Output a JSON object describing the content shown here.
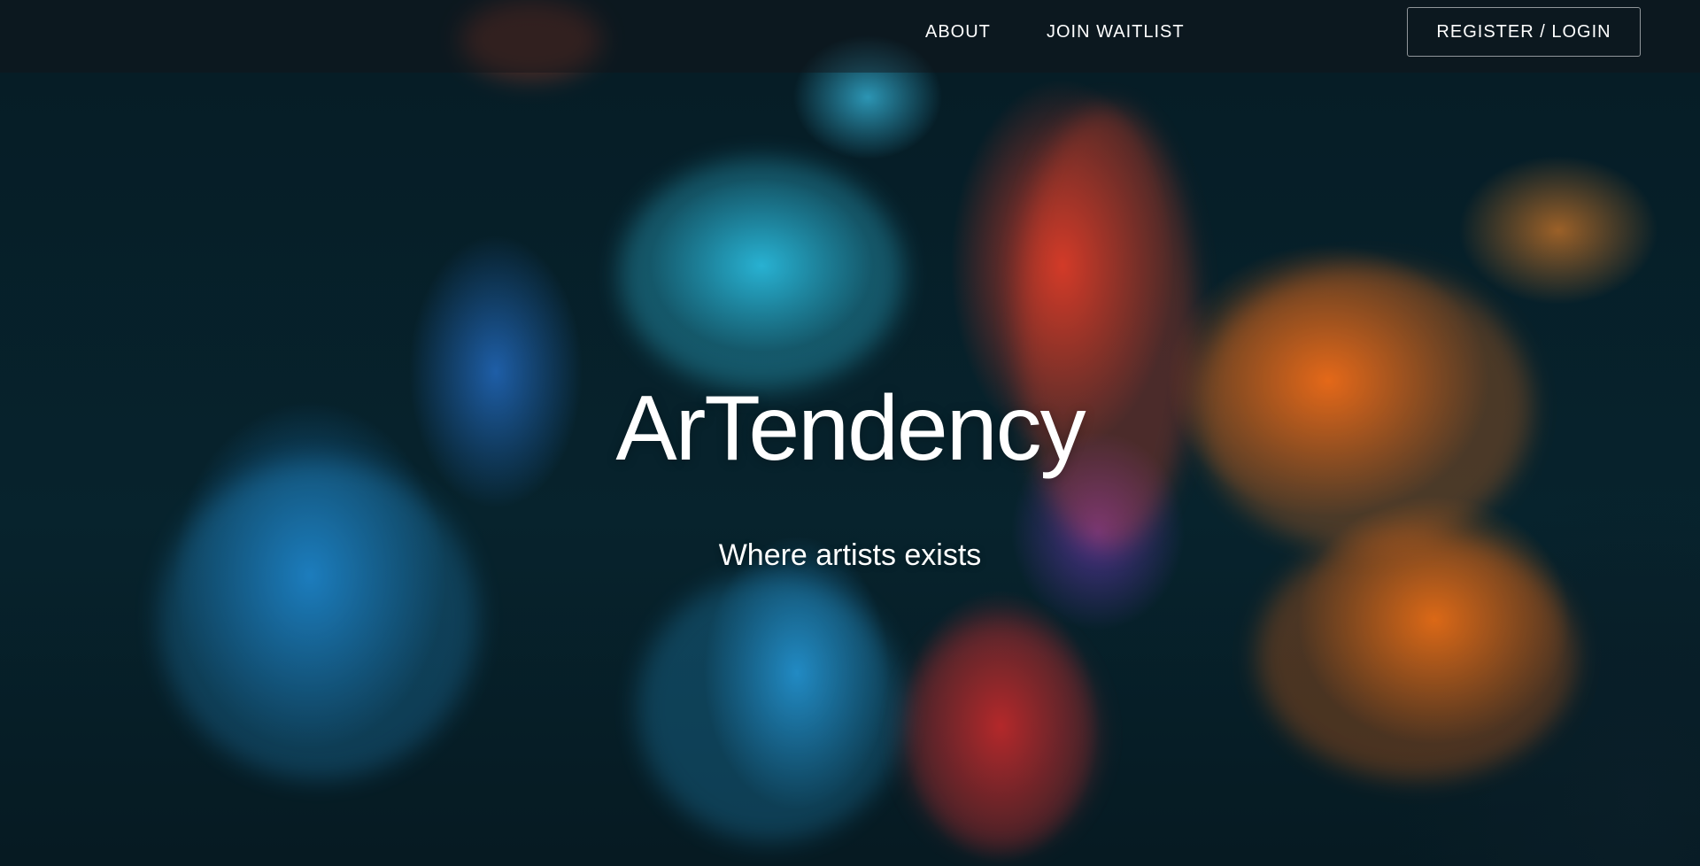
{
  "nav": {
    "about_label": "ABOUT",
    "waitlist_label": "JOIN WAITLIST",
    "login_label": "REGISTER / LOGIN"
  },
  "hero": {
    "title": "ArTendency",
    "subtitle": "Where artists exists"
  },
  "colors": {
    "background": "#06222b",
    "text": "#ffffff",
    "accent_blue": "#28bee1",
    "accent_orange": "#ff6e14",
    "accent_red": "#f03c28"
  }
}
